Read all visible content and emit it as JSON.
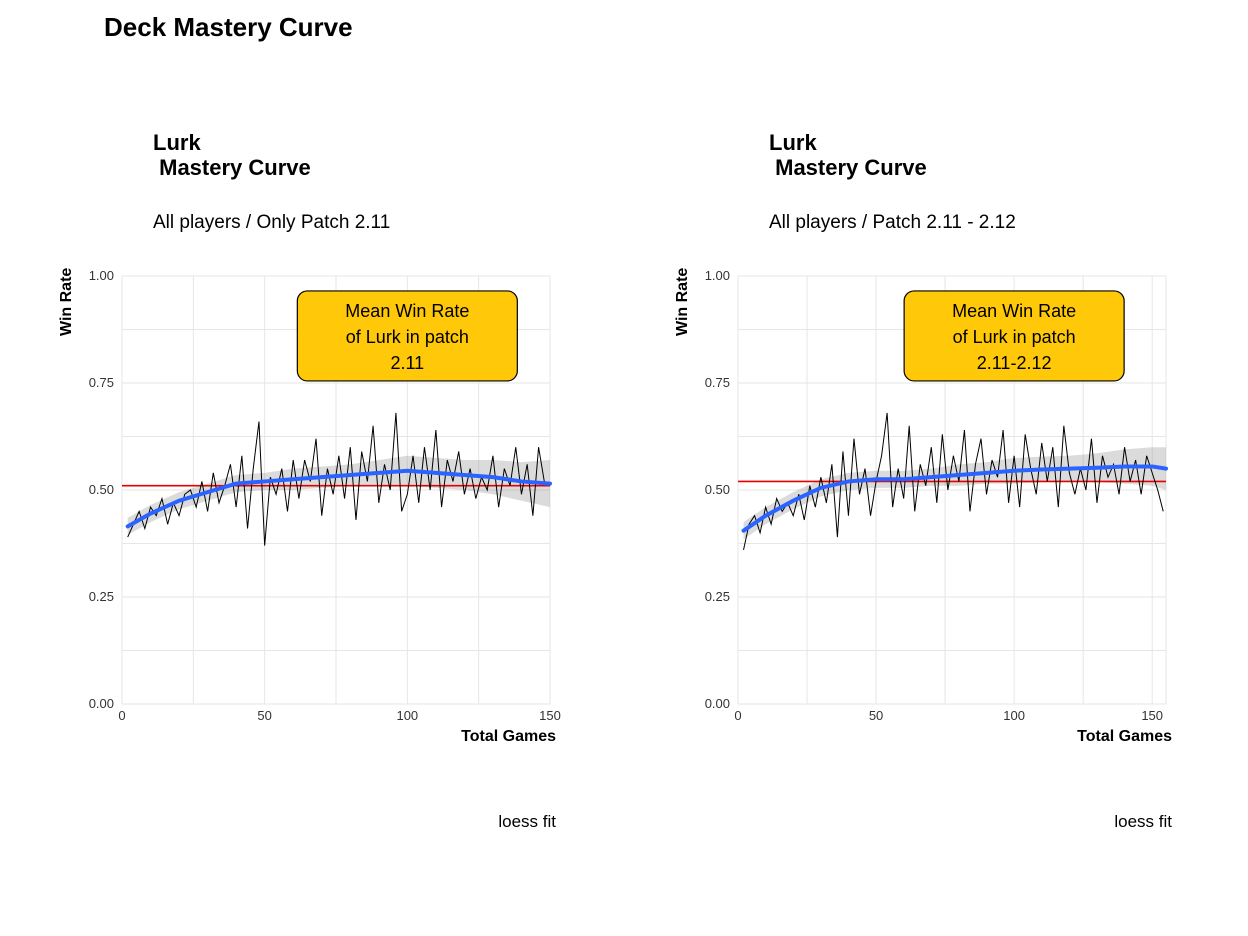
{
  "page": {
    "main_title": "Deck Mastery Curve"
  },
  "charts": {
    "left": {
      "title": "Lurk\n Mastery Curve",
      "subtitle": "All players / Only Patch 2.11",
      "ylabel": "Win Rate",
      "xlabel": "Total Games",
      "caption": "loess fit",
      "annotation": [
        "Mean Win Rate",
        "of Lurk in patch",
        "2.11"
      ]
    },
    "right": {
      "title": "Lurk\n Mastery Curve",
      "subtitle": "All players / Patch 2.11 - 2.12",
      "ylabel": "Win Rate",
      "xlabel": "Total Games",
      "caption": "loess fit",
      "annotation": [
        "Mean Win Rate",
        "of Lurk in patch",
        "2.11-2.12"
      ]
    }
  },
  "colors": {
    "loess_line": "#2b63ff",
    "hline": "#e60000",
    "ann_fill": "#ffc808",
    "grid": "#e6e6e6"
  },
  "chart_data": [
    {
      "type": "line",
      "title": "Lurk Mastery Curve — All players / Only Patch 2.11",
      "xlabel": "Total Games",
      "ylabel": "Win Rate",
      "xlim": [
        0,
        150
      ],
      "ylim": [
        0,
        1
      ],
      "xticks": [
        0,
        50,
        100,
        150
      ],
      "yticks": [
        0.0,
        0.25,
        0.5,
        0.75,
        1.0
      ],
      "hline": {
        "y": 0.51,
        "label": "Mean Win Rate of Lurk in patch 2.11"
      },
      "series": [
        {
          "name": "raw win rate",
          "color": "#000000",
          "x": [
            2,
            4,
            6,
            8,
            10,
            12,
            14,
            16,
            18,
            20,
            22,
            24,
            26,
            28,
            30,
            32,
            34,
            36,
            38,
            40,
            42,
            44,
            46,
            48,
            50,
            52,
            54,
            56,
            58,
            60,
            62,
            64,
            66,
            68,
            70,
            72,
            74,
            76,
            78,
            80,
            82,
            84,
            86,
            88,
            90,
            92,
            94,
            96,
            98,
            100,
            102,
            104,
            106,
            108,
            110,
            112,
            114,
            116,
            118,
            120,
            122,
            124,
            126,
            128,
            130,
            132,
            134,
            136,
            138,
            140,
            142,
            144,
            146,
            148,
            150
          ],
          "y": [
            0.39,
            0.42,
            0.45,
            0.41,
            0.46,
            0.44,
            0.48,
            0.42,
            0.47,
            0.44,
            0.49,
            0.5,
            0.46,
            0.52,
            0.45,
            0.54,
            0.47,
            0.51,
            0.56,
            0.46,
            0.58,
            0.41,
            0.55,
            0.66,
            0.37,
            0.53,
            0.49,
            0.55,
            0.45,
            0.57,
            0.48,
            0.57,
            0.52,
            0.62,
            0.44,
            0.55,
            0.49,
            0.58,
            0.48,
            0.6,
            0.43,
            0.59,
            0.52,
            0.65,
            0.47,
            0.56,
            0.5,
            0.68,
            0.45,
            0.49,
            0.58,
            0.47,
            0.6,
            0.5,
            0.64,
            0.46,
            0.57,
            0.52,
            0.59,
            0.49,
            0.55,
            0.48,
            0.53,
            0.5,
            0.58,
            0.46,
            0.55,
            0.51,
            0.6,
            0.49,
            0.56,
            0.44,
            0.6,
            0.52,
            0.51
          ]
        },
        {
          "name": "loess fit",
          "color": "#2b63ff",
          "x": [
            2,
            10,
            20,
            30,
            40,
            50,
            60,
            70,
            80,
            90,
            100,
            110,
            120,
            130,
            140,
            150
          ],
          "y": [
            0.415,
            0.445,
            0.475,
            0.495,
            0.515,
            0.52,
            0.525,
            0.53,
            0.535,
            0.54,
            0.545,
            0.54,
            0.535,
            0.53,
            0.52,
            0.515
          ]
        },
        {
          "name": "loess ci band",
          "type": "ribbon",
          "color": "#7f7f7f",
          "opacity": 0.28,
          "x": [
            2,
            10,
            20,
            30,
            40,
            50,
            60,
            70,
            80,
            90,
            100,
            110,
            120,
            130,
            140,
            150
          ],
          "y_low": [
            0.395,
            0.425,
            0.455,
            0.475,
            0.495,
            0.5,
            0.5,
            0.505,
            0.51,
            0.51,
            0.51,
            0.505,
            0.5,
            0.49,
            0.475,
            0.46
          ],
          "y_high": [
            0.435,
            0.465,
            0.495,
            0.515,
            0.535,
            0.54,
            0.55,
            0.555,
            0.56,
            0.57,
            0.58,
            0.575,
            0.57,
            0.57,
            0.565,
            0.57
          ]
        }
      ],
      "annotation": {
        "text": "Mean Win Rate of Lurk in patch 2.11",
        "x": 100,
        "y": 0.86
      }
    },
    {
      "type": "line",
      "title": "Lurk Mastery Curve — All players / Patch 2.11 - 2.12",
      "xlabel": "Total Games",
      "ylabel": "Win Rate",
      "xlim": [
        0,
        155
      ],
      "ylim": [
        0,
        1
      ],
      "xticks": [
        0,
        50,
        100,
        150
      ],
      "yticks": [
        0.0,
        0.25,
        0.5,
        0.75,
        1.0
      ],
      "hline": {
        "y": 0.52,
        "label": "Mean Win Rate of Lurk in patch 2.11-2.12"
      },
      "series": [
        {
          "name": "raw win rate",
          "color": "#000000",
          "x": [
            2,
            4,
            6,
            8,
            10,
            12,
            14,
            16,
            18,
            20,
            22,
            24,
            26,
            28,
            30,
            32,
            34,
            36,
            38,
            40,
            42,
            44,
            46,
            48,
            50,
            52,
            54,
            56,
            58,
            60,
            62,
            64,
            66,
            68,
            70,
            72,
            74,
            76,
            78,
            80,
            82,
            84,
            86,
            88,
            90,
            92,
            94,
            96,
            98,
            100,
            102,
            104,
            106,
            108,
            110,
            112,
            114,
            116,
            118,
            120,
            122,
            124,
            126,
            128,
            130,
            132,
            134,
            136,
            138,
            140,
            142,
            144,
            146,
            148,
            150,
            152,
            154
          ],
          "y": [
            0.36,
            0.42,
            0.44,
            0.4,
            0.46,
            0.42,
            0.48,
            0.45,
            0.47,
            0.44,
            0.49,
            0.43,
            0.51,
            0.46,
            0.53,
            0.47,
            0.56,
            0.39,
            0.59,
            0.44,
            0.62,
            0.49,
            0.55,
            0.44,
            0.52,
            0.58,
            0.68,
            0.46,
            0.55,
            0.48,
            0.65,
            0.45,
            0.56,
            0.51,
            0.6,
            0.47,
            0.63,
            0.5,
            0.58,
            0.52,
            0.64,
            0.45,
            0.56,
            0.62,
            0.49,
            0.57,
            0.53,
            0.64,
            0.47,
            0.58,
            0.46,
            0.63,
            0.55,
            0.49,
            0.61,
            0.52,
            0.6,
            0.46,
            0.65,
            0.54,
            0.49,
            0.55,
            0.5,
            0.62,
            0.47,
            0.58,
            0.53,
            0.56,
            0.49,
            0.6,
            0.52,
            0.57,
            0.49,
            0.58,
            0.54,
            0.5,
            0.45
          ]
        },
        {
          "name": "loess fit",
          "color": "#2b63ff",
          "x": [
            2,
            10,
            20,
            30,
            40,
            50,
            60,
            70,
            80,
            90,
            100,
            110,
            120,
            130,
            140,
            150,
            155
          ],
          "y": [
            0.405,
            0.44,
            0.475,
            0.505,
            0.52,
            0.525,
            0.525,
            0.53,
            0.535,
            0.54,
            0.545,
            0.548,
            0.55,
            0.552,
            0.555,
            0.555,
            0.55
          ]
        },
        {
          "name": "loess ci band",
          "type": "ribbon",
          "color": "#7f7f7f",
          "opacity": 0.28,
          "x": [
            2,
            10,
            20,
            30,
            40,
            50,
            60,
            70,
            80,
            90,
            100,
            110,
            120,
            130,
            140,
            150,
            155
          ],
          "y_low": [
            0.385,
            0.42,
            0.455,
            0.485,
            0.5,
            0.505,
            0.505,
            0.51,
            0.51,
            0.515,
            0.515,
            0.518,
            0.52,
            0.518,
            0.515,
            0.51,
            0.5
          ],
          "y_high": [
            0.425,
            0.46,
            0.495,
            0.525,
            0.54,
            0.545,
            0.545,
            0.55,
            0.56,
            0.565,
            0.575,
            0.578,
            0.58,
            0.586,
            0.595,
            0.6,
            0.6
          ]
        }
      ],
      "annotation": {
        "text": "Mean Win Rate of Lurk in patch 2.11-2.12",
        "x": 100,
        "y": 0.86
      }
    }
  ]
}
